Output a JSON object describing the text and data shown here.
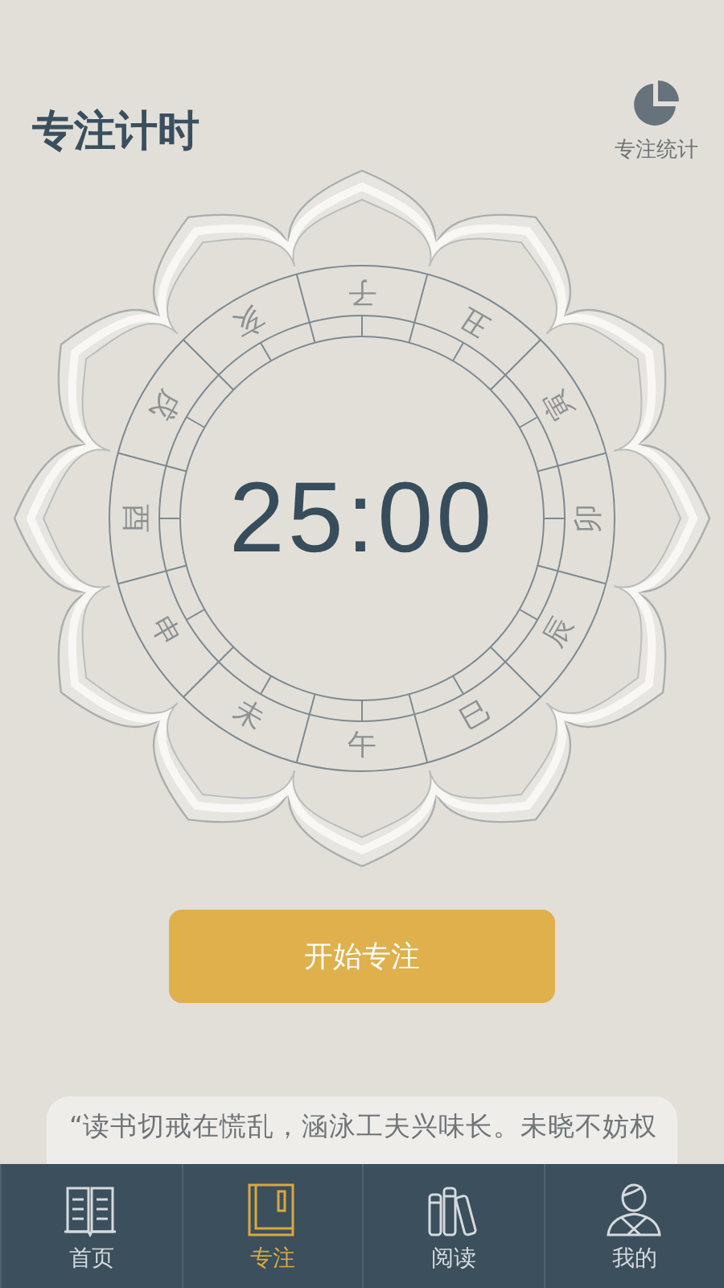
{
  "header": {
    "title": "专注计时",
    "stats_label": "专注统计"
  },
  "dial": {
    "time": "25:00",
    "branches": [
      "子",
      "丑",
      "寅",
      "卯",
      "辰",
      "巳",
      "午",
      "未",
      "申",
      "酉",
      "戌",
      "亥"
    ]
  },
  "start_button": "开始专注",
  "quote": "“读书切戒在慌乱，涵泳工夫兴味长。未晓不妨权",
  "tabs": [
    {
      "label": "首页",
      "selected": false
    },
    {
      "label": "专注",
      "selected": true
    },
    {
      "label": "阅读",
      "selected": false
    },
    {
      "label": "我的",
      "selected": false
    }
  ]
}
